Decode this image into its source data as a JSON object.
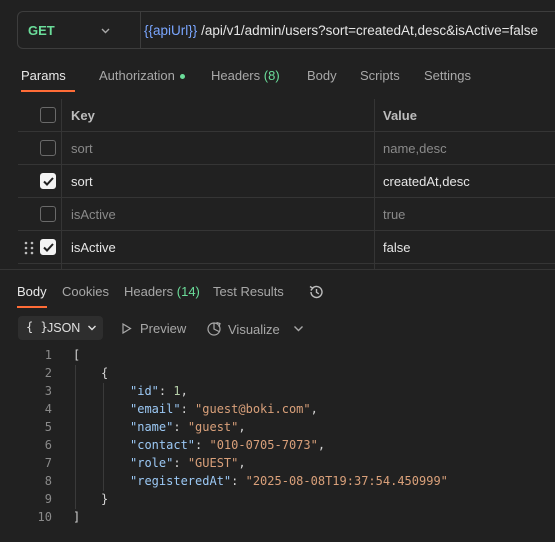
{
  "request": {
    "method": "GET",
    "url_var": "{{apiUrl}}",
    "url_path": "/api/v1/admin/users?sort=createdAt,desc&isActive=false"
  },
  "request_tabs": {
    "params": "Params",
    "authorization": "Authorization",
    "headers": "Headers",
    "headers_count": "(8)",
    "body": "Body",
    "scripts": "Scripts",
    "settings": "Settings"
  },
  "params_table": {
    "key_header": "Key",
    "value_header": "Value",
    "rows": [
      {
        "key": "sort",
        "value": "name,desc",
        "checked": false
      },
      {
        "key": "sort",
        "value": "createdAt,desc",
        "checked": true
      },
      {
        "key": "isActive",
        "value": "true",
        "checked": false
      },
      {
        "key": "isActive",
        "value": "false",
        "checked": true
      }
    ]
  },
  "response_tabs": {
    "body": "Body",
    "cookies": "Cookies",
    "headers": "Headers",
    "headers_count": "(14)",
    "test_results": "Test Results"
  },
  "response_toolbar": {
    "format_icon": "{ }",
    "format": "JSON",
    "preview": "Preview",
    "visualize": "Visualize"
  },
  "code": {
    "line_numbers": [
      "1",
      "2",
      "3",
      "4",
      "5",
      "6",
      "7",
      "8",
      "9",
      "10"
    ],
    "open_bracket": "[",
    "open_brace": "{",
    "close_brace": "}",
    "close_bracket": "]",
    "fields": [
      {
        "key": "\"id\"",
        "value": "1",
        "comma": ","
      },
      {
        "key": "\"email\"",
        "value": "\"guest@boki.com\"",
        "comma": ","
      },
      {
        "key": "\"name\"",
        "value": "\"guest\"",
        "comma": ","
      },
      {
        "key": "\"contact\"",
        "value": "\"010-0705-7073\"",
        "comma": ","
      },
      {
        "key": "\"role\"",
        "value": "\"GUEST\"",
        "comma": ","
      },
      {
        "key": "\"registeredAt\"",
        "value": "\"2025-08-08T19:37:54.450999\"",
        "comma": ""
      }
    ]
  },
  "colors": {
    "accent": "#ff6c37",
    "method_get": "#6bdd9a",
    "variable": "#7aa6ff",
    "json_key": "#9cc9f5",
    "json_string": "#d9a07a"
  }
}
